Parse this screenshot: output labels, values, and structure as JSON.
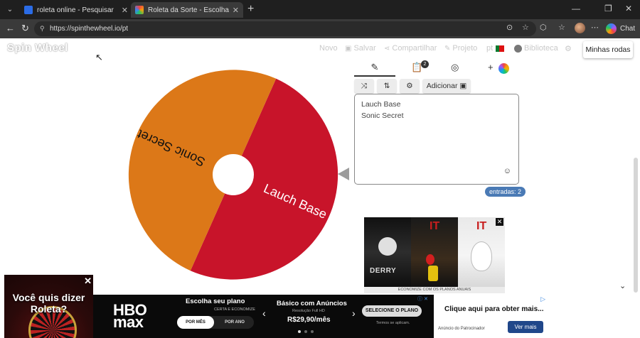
{
  "browser": {
    "tabs": [
      {
        "title": "roleta online - Pesquisar",
        "favicon_color": "#2b6ce6"
      },
      {
        "title": "Roleta da Sorte - Escolha Personali",
        "favicon_color": "#f0b429"
      }
    ],
    "url": "https://spinthewheel.io/pt",
    "chat_label": "Chat",
    "new_tab_icon": "plus-icon"
  },
  "site": {
    "logo": "Spin Wheel",
    "nav": {
      "novo": "Novo",
      "salvar": "Salvar",
      "compartilhar": "Compartilhar",
      "projeto": "Projeto",
      "lang": "pt",
      "biblioteca": "Biblioteca",
      "minhas_rodas": "Minhas rodas"
    }
  },
  "wheel": {
    "segments": [
      {
        "label": "Lauch Base",
        "color": "#c8142a"
      },
      {
        "label": "Sonic Secret",
        "color": "#dc7818"
      }
    ]
  },
  "editor": {
    "list_badge": "2",
    "adicionar": "Adicionar",
    "entries": [
      "Lauch Base",
      "Sonic Secret"
    ],
    "count_label": "entradas: 2"
  },
  "ads": {
    "poster": {
      "title_1": "IT",
      "title_2": "IT",
      "derry": "DERRY",
      "footer": "ECONOMIZE COM OS PLANOS ANUAIS"
    },
    "corner": {
      "text": "Você quis dizer Roleta?"
    },
    "bottom": {
      "brand": "HBO max",
      "plan_title": "Escolha seu plano",
      "plan_sub": "CERTA E ECONOMIZE",
      "toggle_monthly": "POR MÊS",
      "toggle_yearly": "POR ANO",
      "basic_title": "Básico com Anúncios",
      "basic_small": "Resolução Full HD",
      "price": "R$29,90/mês",
      "select_label": "SELECIONE O PLANO",
      "terms": "Termos se aplicam.",
      "sponsor_head": "Clique aqui para obter mais...",
      "sponsor_small": "Anúncio do Patrocinador",
      "sponsor_button": "Ver mais"
    }
  }
}
